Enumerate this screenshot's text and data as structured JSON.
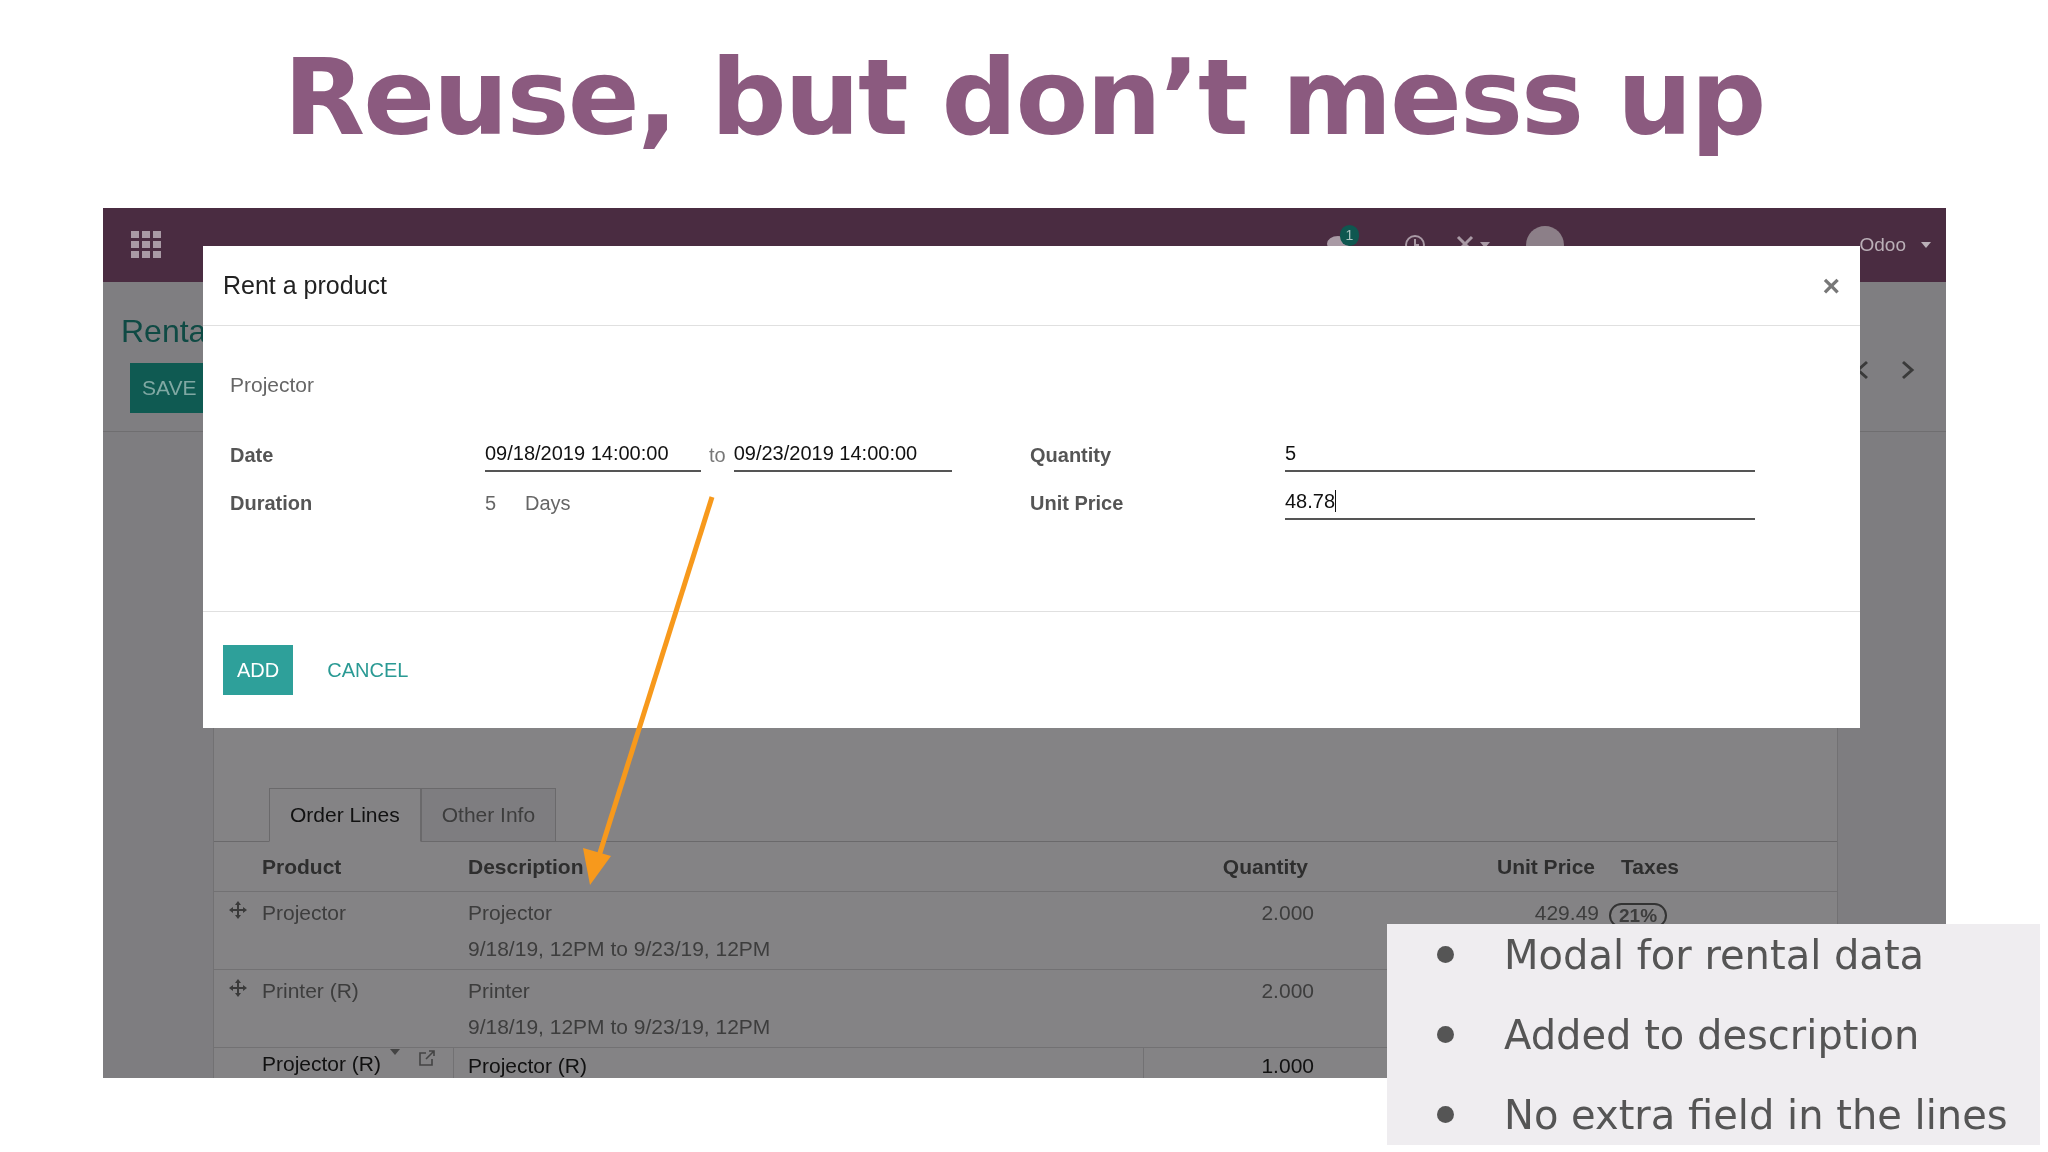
{
  "slide": {
    "title": "Reuse, but don’t mess up",
    "bullets": [
      "Modal for rental data",
      "Added to description",
      "No extra field in the lines"
    ]
  },
  "navbar": {
    "messages_count": "1",
    "company": "Odoo"
  },
  "control_panel": {
    "breadcrumb": "Renta",
    "save": "SAVE"
  },
  "modal": {
    "title": "Rent a product",
    "close": "×",
    "product": "Projector",
    "date": {
      "label": "Date",
      "from": "09/18/2019 14:00:00",
      "separator": "to",
      "to": "09/23/2019 14:00:00"
    },
    "duration": {
      "label": "Duration",
      "value": "5",
      "unit": "Days"
    },
    "quantity": {
      "label": "Quantity",
      "value": "5"
    },
    "unit_price": {
      "label": "Unit Price",
      "value": "48.78",
      "focused": true
    },
    "buttons": [
      {
        "label": "ADD",
        "kind": "primary"
      },
      {
        "label": "CANCEL",
        "kind": "link"
      }
    ]
  },
  "tabs": [
    {
      "label": "Order Lines",
      "selected": true
    },
    {
      "label": "Other Info",
      "selected": false
    }
  ],
  "table": {
    "columns": [
      "Product",
      "Description",
      "Quantity",
      "Unit Price",
      "Taxes"
    ],
    "rows": [
      {
        "kind": "line",
        "product": "Projector",
        "description": [
          "Projector",
          "9/18/19, 12PM to 9/23/19, 12PM"
        ],
        "quantity": "2.000",
        "unit_price": "429.49",
        "taxes": "21%"
      },
      {
        "kind": "line",
        "product": "Printer (R)",
        "description": [
          "Printer",
          "9/18/19, 12PM to 9/23/19, 12PM"
        ],
        "quantity": "2.000"
      },
      {
        "kind": "editing",
        "product": "Projector (R)",
        "description": [
          "Projector (R)"
        ],
        "quantity": "1.000"
      }
    ]
  }
}
